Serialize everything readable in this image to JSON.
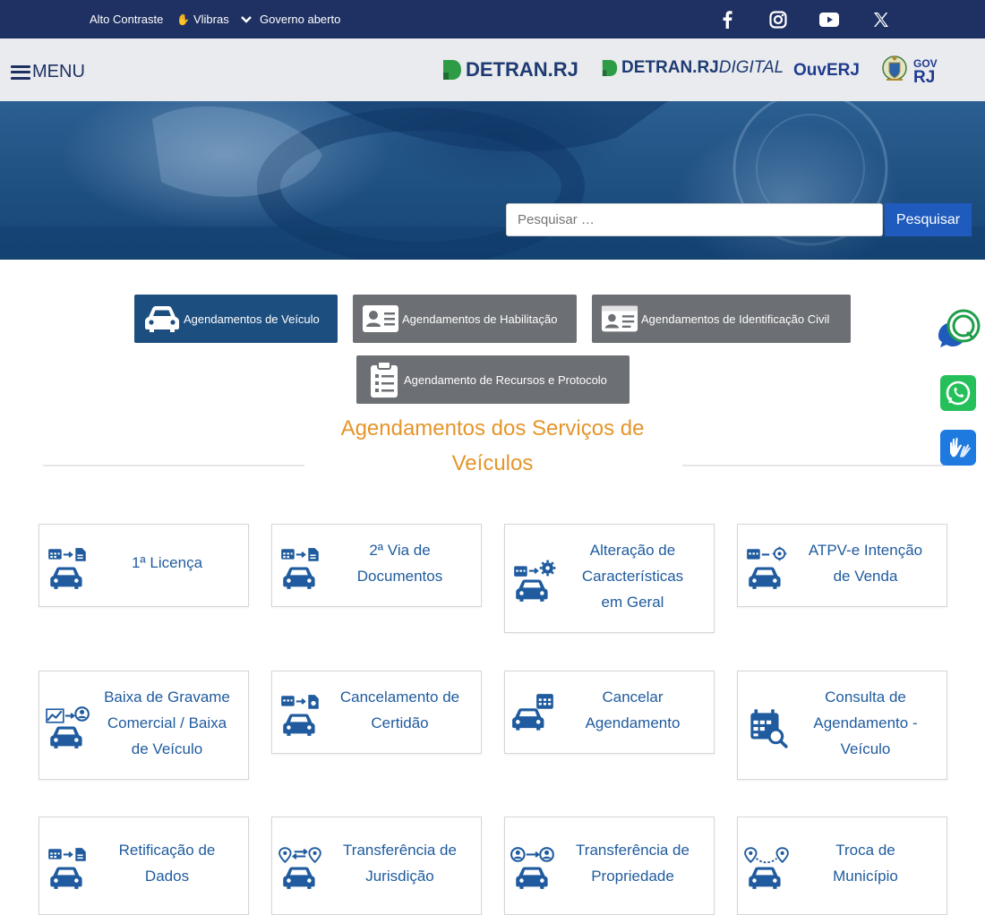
{
  "topbar": {
    "alto_contraste": "Alto Contraste",
    "vlibras": "Vlibras",
    "governo_aberto": "Governo aberto"
  },
  "header": {
    "menu_label": "MENU",
    "logos": {
      "detran": "DETRAN.RJ",
      "detran_digital_a": "DETRAN.RJ",
      "detran_digital_b": "DIGITAL",
      "ouverj": "OuvERJ",
      "gov_a": "GOV",
      "gov_b": "RJ"
    }
  },
  "search": {
    "placeholder": "Pesquisar …",
    "button": "Pesquisar"
  },
  "tabs": [
    {
      "label": "Agendamentos de Veículo",
      "active": true,
      "icon": "car-icon"
    },
    {
      "label": "Agendamentos de Habilitação",
      "active": false,
      "icon": "id-card-icon"
    },
    {
      "label": "Agendamentos de Identificação Civil",
      "active": false,
      "icon": "id-card-icon"
    },
    {
      "label": "Agendamento de Recursos e Protocolo",
      "active": false,
      "icon": "clipboard-icon"
    }
  ],
  "section": {
    "title_line1": "Agendamentos dos Serviços de",
    "title_line2": "Veículos"
  },
  "cards": [
    {
      "lines": [
        "1ª Licença"
      ],
      "icon": "car-calendar-document-icon"
    },
    {
      "lines": [
        "2ª Via de",
        "Documentos"
      ],
      "icon": "car-calendar-document-icon"
    },
    {
      "lines": [
        "Alteração de",
        "Características",
        "em Geral"
      ],
      "icon": "car-calendar-gear-icon"
    },
    {
      "lines": [
        "ATPV-e Intenção",
        "de Venda"
      ],
      "icon": "car-calendar-target-icon"
    },
    {
      "lines": [
        "Baixa de Gravame",
        "Comercial / Baixa",
        "de Veículo"
      ],
      "icon": "car-chart-person-icon"
    },
    {
      "lines": [
        "Cancelamento de",
        "Certidão"
      ],
      "icon": "car-calendar-certificate-icon"
    },
    {
      "lines": [
        "Cancelar",
        "Agendamento"
      ],
      "icon": "car-calendar-cancel-icon"
    },
    {
      "lines": [
        "Consulta de",
        "Agendamento -",
        "Veículo"
      ],
      "icon": "calendar-search-icon"
    },
    {
      "lines": [
        "Retificação de",
        "Dados"
      ],
      "icon": "car-calendar-document-icon"
    },
    {
      "lines": [
        "Transferência de",
        "Jurisdição"
      ],
      "icon": "car-location-icon"
    },
    {
      "lines": [
        "Transferência de",
        "Propriedade"
      ],
      "icon": "car-person-transfer-icon"
    },
    {
      "lines": [
        "Troca de",
        "Município"
      ],
      "icon": "car-location-pins-icon"
    }
  ],
  "colors": {
    "navy": "#1f3163",
    "primary": "#1d4e80",
    "accent_orange": "#e5952c",
    "card_text": "#1f5b9e",
    "tab_inactive": "#6c6f73",
    "search_button": "#1f5bbd"
  }
}
